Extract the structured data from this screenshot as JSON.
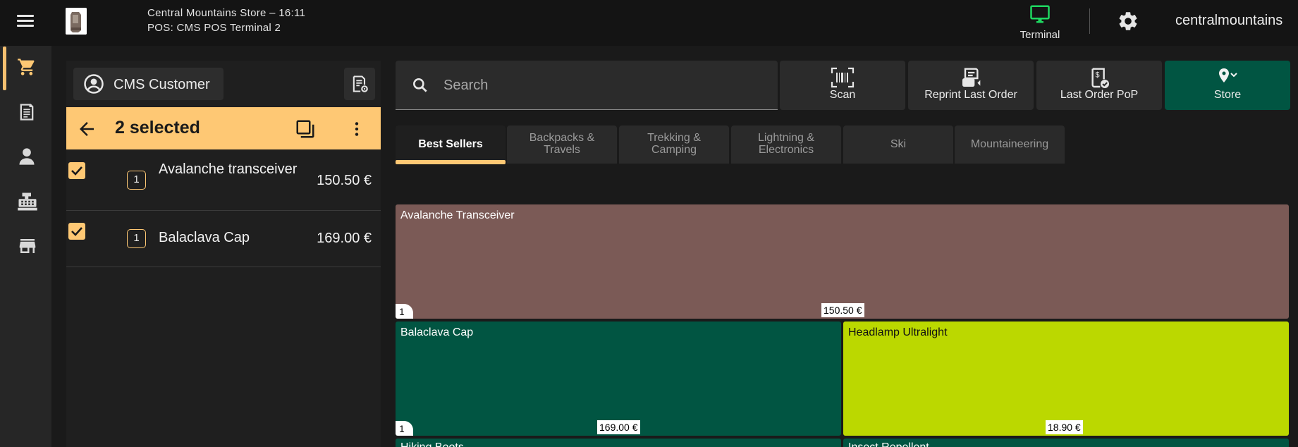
{
  "header": {
    "store_line": "Central Mountains Store – 16:11",
    "pos_line": "POS: CMS POS Terminal 2",
    "terminal_label": "Terminal",
    "username": "centralmountains",
    "terminal_color": "#1ed760"
  },
  "rail": {
    "items": [
      {
        "name": "cart",
        "active": true
      },
      {
        "name": "receipts",
        "active": false
      },
      {
        "name": "customer",
        "active": false
      },
      {
        "name": "cash-register",
        "active": false
      },
      {
        "name": "store",
        "active": false
      }
    ]
  },
  "order": {
    "customer": "CMS Customer",
    "selection_text": "2 selected",
    "lines": [
      {
        "checked": true,
        "qty": "1",
        "name": "Avalanche transceiver",
        "price": "150.50 €"
      },
      {
        "checked": true,
        "qty": "1",
        "name": "Balaclava Cap",
        "price": "169.00 €"
      }
    ]
  },
  "toolbar": {
    "search_placeholder": "Search",
    "scan": "Scan",
    "reprint": "Reprint Last Order",
    "last_pop": "Last Order PoP",
    "store": "Store"
  },
  "tabs": [
    {
      "line1": "Best Sellers",
      "line2": "",
      "active": true
    },
    {
      "line1": "Backpacks &",
      "line2": "Travels",
      "active": false
    },
    {
      "line1": "Trekking &",
      "line2": "Camping",
      "active": false
    },
    {
      "line1": "Lightning &",
      "line2": "Electronics",
      "active": false
    },
    {
      "line1": "Ski",
      "line2": "",
      "active": false
    },
    {
      "line1": "Mountaineering",
      "line2": "",
      "active": false
    }
  ],
  "products": [
    {
      "name": "Avalanche Transceiver",
      "count": "1",
      "price": "150.50 €",
      "color": "#7b5a56"
    },
    {
      "name": "Balaclava Cap",
      "count": "1",
      "price": "169.00 €",
      "color": "#015542"
    },
    {
      "name": "Headlamp Ultralight",
      "count": "",
      "price": "18.90 €",
      "color": "#bbd800"
    },
    {
      "name": "Hiking Boots",
      "count": "",
      "price": "",
      "color": "#015542"
    },
    {
      "name": "Insect Repellent",
      "count": "",
      "price": "",
      "color": "#015542"
    }
  ],
  "colors": {
    "accent": "#fec874",
    "store_button": "#015542"
  }
}
